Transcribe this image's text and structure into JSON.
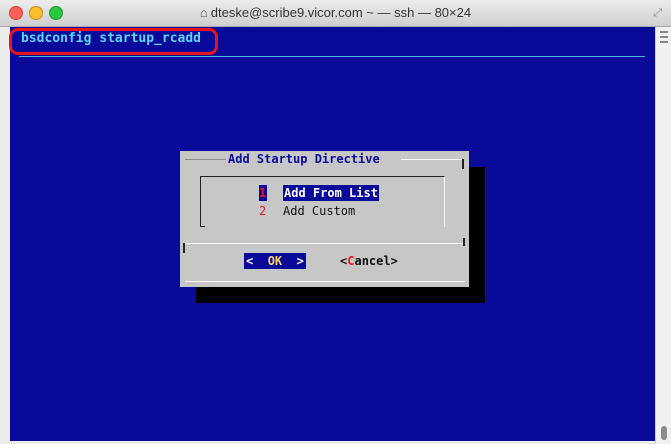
{
  "window": {
    "title": "dteske@scribe9.vicor.com ~ — ssh — 80×24"
  },
  "terminal": {
    "backtitle": "bsdconfig startup_rcadd"
  },
  "dialog": {
    "title": "Add Startup Directive",
    "menu_items": [
      {
        "tag": "1",
        "label": "Add From List",
        "selected": true
      },
      {
        "tag": "2",
        "label": "Add Custom",
        "selected": false
      }
    ],
    "buttons": {
      "ok_left": "<",
      "ok_hotkey": "OK",
      "ok_right": ">",
      "cancel_open": "<",
      "cancel_hotkey": "C",
      "cancel_rest": "ancel>"
    }
  },
  "colors": {
    "terminal_bg": "#0a0a9a",
    "backtitle": "#5ad6ff",
    "dialog_bg": "#c7c7c7",
    "highlight_ring": "#e8141b"
  },
  "icons": {
    "home": "home-icon",
    "resize": "resize-icon"
  }
}
